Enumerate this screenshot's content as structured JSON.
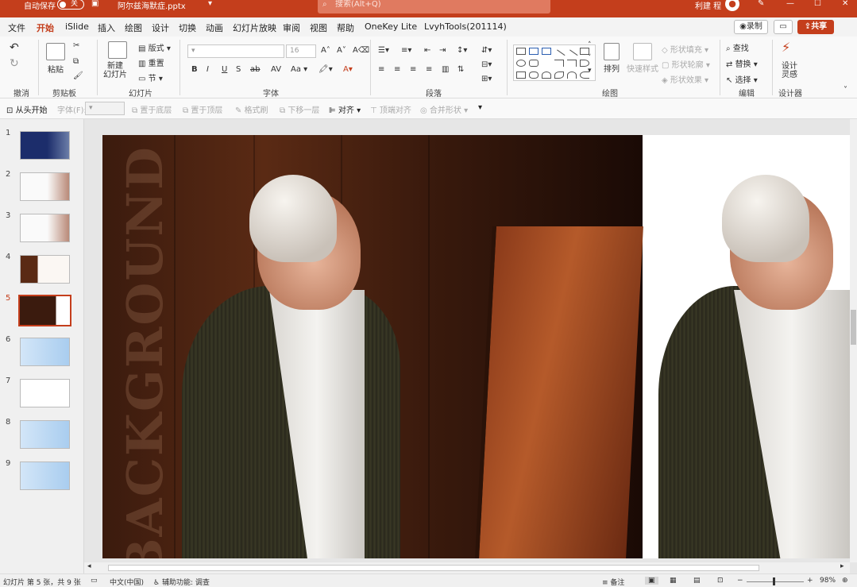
{
  "titlebar": {
    "autosave_label": "自动保存",
    "autosave_state": "关",
    "filename": "阿尔兹海默症.pptx",
    "search_placeholder": "搜索(Alt+Q)",
    "user_name": "利建 程"
  },
  "menu": {
    "items": [
      "文件",
      "开始",
      "iSlide",
      "插入",
      "绘图",
      "设计",
      "切换",
      "动画",
      "幻灯片放映",
      "审阅",
      "视图",
      "帮助",
      "OneKey Lite",
      "LvyhTools(201114)"
    ],
    "active": "开始",
    "record_label": "录制",
    "share_label": "共享"
  },
  "ribbon": {
    "groups": [
      "撤消",
      "剪贴板",
      "幻灯片",
      "字体",
      "段落",
      "绘图",
      "编辑",
      "设计器"
    ],
    "paste_label": "粘贴",
    "new_slide_label": "新建\n幻灯片",
    "layout_label": "版式",
    "reset_label": "重置",
    "section_label": "节",
    "font_size": "16",
    "arrange_label": "排列",
    "quick_style_label": "快速样式",
    "shape_fill_label": "形状填充",
    "shape_outline_label": "形状轮廓",
    "shape_effect_label": "形状效果",
    "find_label": "查找",
    "replace_label": "替换",
    "select_label": "选择",
    "designer_label": "设计\n灵感"
  },
  "quick_access": {
    "items": [
      "从头开始",
      "字体(F):",
      "置于底层",
      "置于顶层",
      "格式刷",
      "下移一层",
      "对齐",
      "顶端对齐",
      "合并形状"
    ]
  },
  "thumbnails": {
    "numbers": [
      "1",
      "2",
      "3",
      "4",
      "5",
      "6",
      "7",
      "8",
      "9"
    ],
    "selected": "5"
  },
  "slide": {
    "background_text": "BACKGROUND"
  },
  "statusbar": {
    "slide_info": "幻灯片 第 5 张，共 9 张",
    "language": "中文(中国)",
    "accessibility": "辅助功能: 调查",
    "notes_label": "备注",
    "zoom": "98%"
  },
  "colors": {
    "accent": "#c43e1c",
    "titlebar": "#c43e1c",
    "ribbon_bg": "#f9f9f9"
  }
}
